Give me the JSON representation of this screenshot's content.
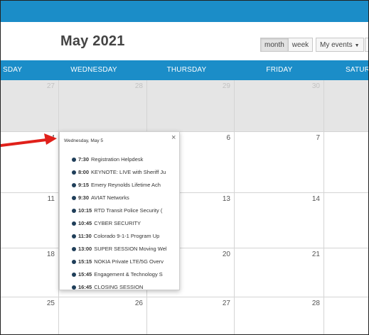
{
  "calendar": {
    "month_title": "May 2021",
    "views": [
      "month",
      "week"
    ],
    "active_view": "month",
    "events_filter": "My events"
  },
  "days_header": [
    "SDAY",
    "WEDNESDAY",
    "THURSDAY",
    "FRIDAY",
    "SATUR"
  ],
  "weeks": [
    {
      "days": [
        "27",
        "28",
        "29",
        "30",
        ""
      ],
      "previous_month": true
    },
    {
      "days": [
        "4",
        "",
        "6",
        "7",
        ""
      ],
      "previous_month": false
    },
    {
      "days": [
        "11",
        "",
        "13",
        "14",
        ""
      ],
      "previous_month": false
    },
    {
      "days": [
        "18",
        "",
        "20",
        "21",
        ""
      ],
      "previous_month": false
    },
    {
      "days": [
        "25",
        "26",
        "27",
        "28",
        ""
      ],
      "previous_month": false
    }
  ],
  "popup": {
    "date_label": "Wednesday, May 5",
    "close_icon": "×",
    "events": [
      {
        "time": "7:30",
        "title": "Registration Helpdesk"
      },
      {
        "time": "8:00",
        "title": "KEYNOTE: LIVE with Sheriff Ju"
      },
      {
        "time": "9:15",
        "title": "Emery Reynolds Lifetime Ach"
      },
      {
        "time": "9:30",
        "title": "AVIAT Networks"
      },
      {
        "time": "10:15",
        "title": "RTD Transit Police Security ("
      },
      {
        "time": "10:45",
        "title": "CYBER SECURITY"
      },
      {
        "time": "11:30",
        "title": "Colorado 9-1-1 Program Up"
      },
      {
        "time": "13:00",
        "title": "SUPER SESSION Moving Wel"
      },
      {
        "time": "15:15",
        "title": "NOKIA Private LTE/5G Overv"
      },
      {
        "time": "15:45",
        "title": "Engagement & Technology S"
      },
      {
        "time": "16:45",
        "title": "CLOSING SESSION"
      }
    ]
  },
  "colors": {
    "header_blue": "#1b8dc8",
    "event_dot": "#1f3e59",
    "annotation_arrow": "#e0201a",
    "prev_month_bg": "#e5e5e5"
  },
  "icons": {
    "dropdown_caret": "caret-down-icon",
    "annotation": "red-arrow-icon"
  }
}
